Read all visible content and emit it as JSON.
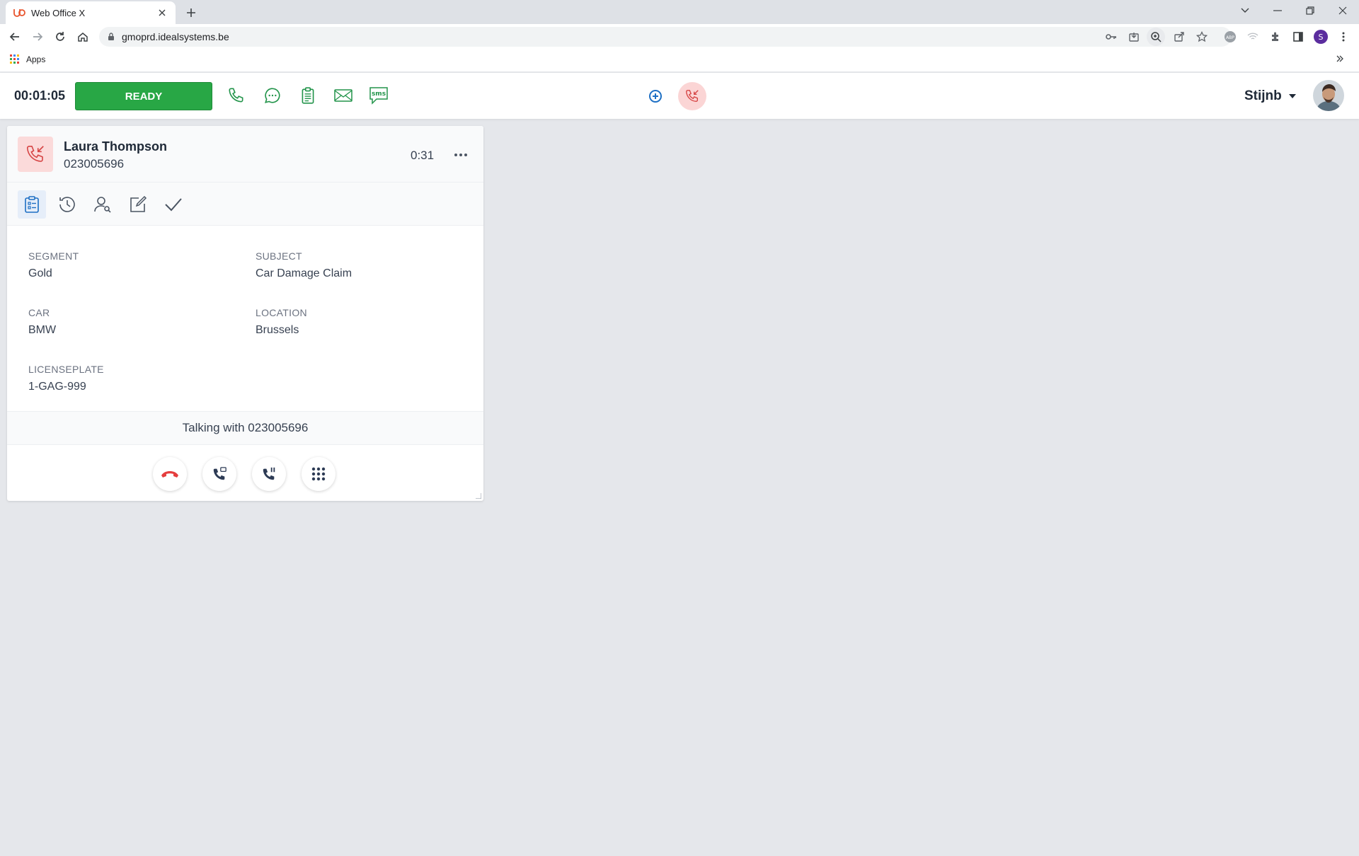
{
  "browser": {
    "tab_title": "Web Office X",
    "url": "gmoprd.idealsystems.be",
    "bookmarks": {
      "apps_label": "Apps"
    },
    "profile_initial": "S",
    "abp_label": "ABP"
  },
  "header": {
    "timer": "00:01:05",
    "ready_label": "READY",
    "sms_label": "sms",
    "user_name": "Stijnb"
  },
  "card": {
    "contact_name": "Laura Thompson",
    "contact_phone": "023005696",
    "duration": "0:31",
    "fields": [
      {
        "label": "SEGMENT",
        "value": "Gold"
      },
      {
        "label": "SUBJECT",
        "value": "Car Damage Claim"
      },
      {
        "label": "CAR",
        "value": "BMW"
      },
      {
        "label": "LOCATION",
        "value": "Brussels"
      },
      {
        "label": "LICENSEPLATE",
        "value": "1-GAG-999"
      }
    ],
    "status_text": "Talking with 023005696"
  },
  "colors": {
    "ready_green": "#28a745",
    "channel_green": "#22944a",
    "hangup_red": "#e53e3e",
    "incoming_bg": "#fbd5d5",
    "accent_blue": "#1d6fc4"
  }
}
